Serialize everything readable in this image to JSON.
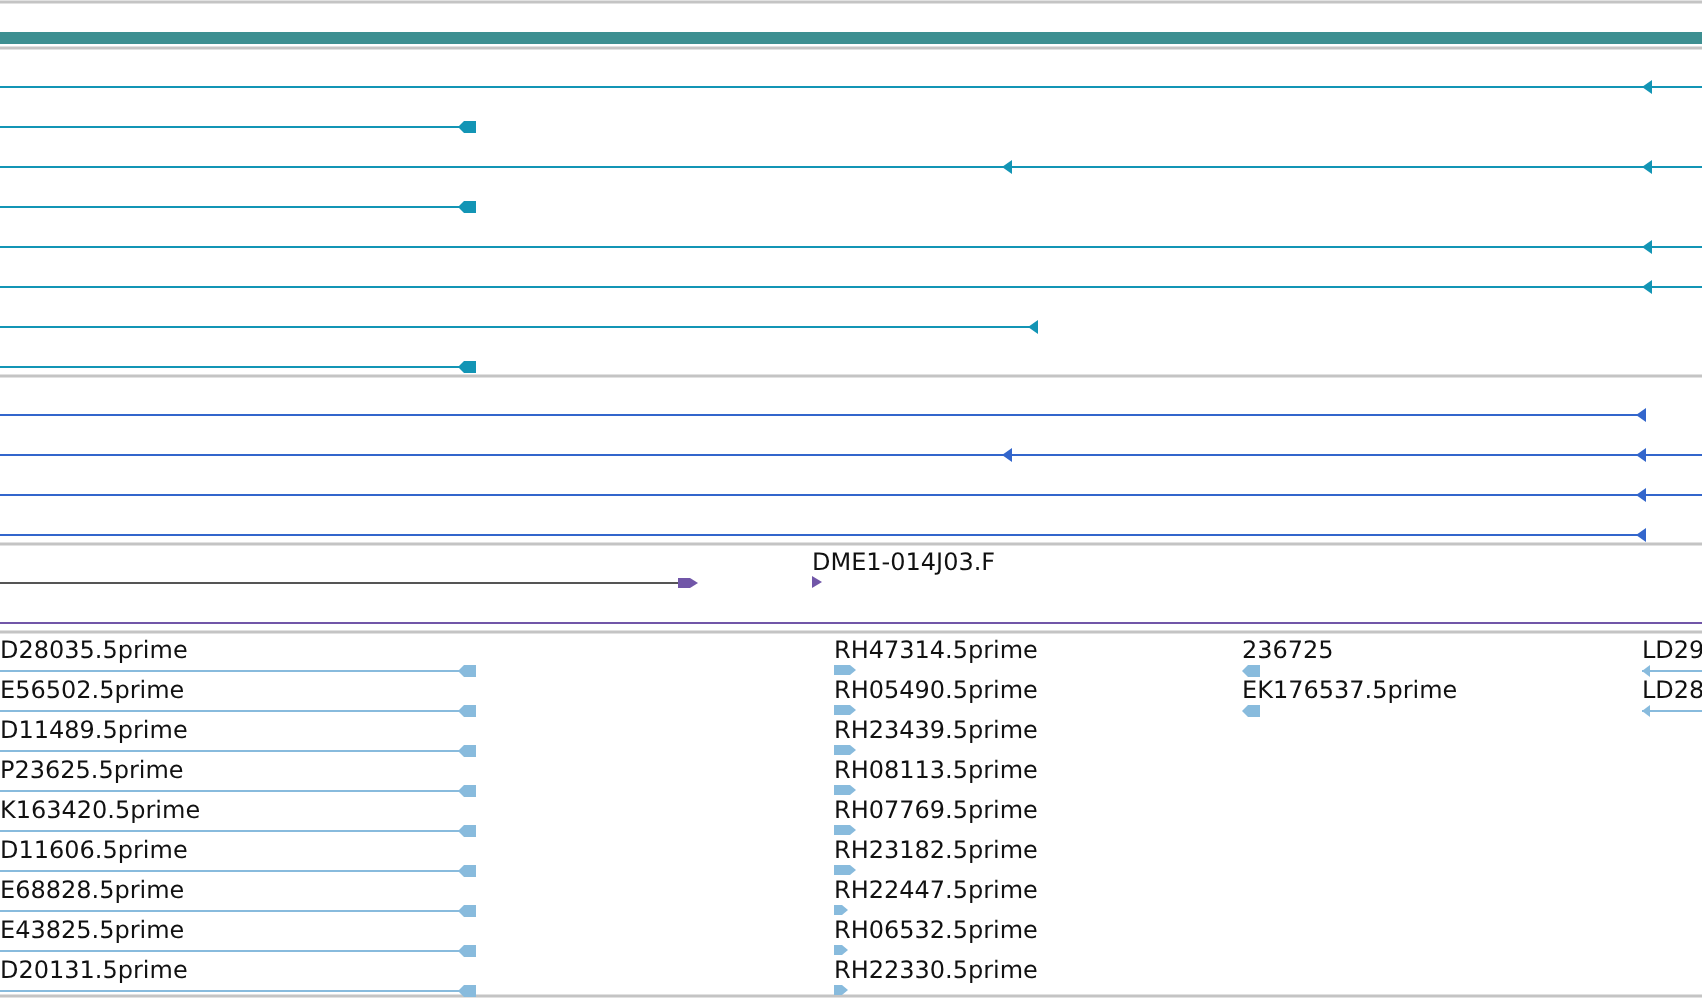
{
  "tracks": [
    {
      "kind": "bar",
      "color": "#3d8f91"
    },
    {
      "kind": "transcripts",
      "color": "#1395b5",
      "rows": [
        {
          "reverse": true
        },
        {
          "reverse": true
        },
        {
          "reverse": true
        },
        {
          "reverse": true
        },
        {
          "reverse": true
        },
        {
          "reverse": true
        },
        {
          "reverse": true
        },
        {
          "reverse": true
        }
      ]
    },
    {
      "kind": "transcripts",
      "color": "#3366cc",
      "rows": [
        {
          "reverse": true
        },
        {
          "reverse": true
        },
        {
          "reverse": true
        },
        {
          "reverse": true
        }
      ]
    },
    {
      "kind": "clones",
      "color": "#7156a8",
      "features": [
        {
          "reverse": false
        },
        {
          "label": "DME1-014J03.F",
          "reverse": false
        }
      ]
    },
    {
      "kind": "ests",
      "color": "#88bbdd",
      "columns": [
        {
          "items": [
            {
              "label": "D28035.5prime",
              "reverse": true
            },
            {
              "label": "E56502.5prime",
              "reverse": true
            },
            {
              "label": "D11489.5prime",
              "reverse": true
            },
            {
              "label": "P23625.5prime",
              "reverse": true
            },
            {
              "label": "K163420.5prime",
              "reverse": true
            },
            {
              "label": "D11606.5prime",
              "reverse": true
            },
            {
              "label": "E68828.5prime",
              "reverse": true
            },
            {
              "label": "E43825.5prime",
              "reverse": true
            },
            {
              "label": "D20131.5prime",
              "reverse": true
            }
          ]
        },
        {
          "items": [
            {
              "label": "RH47314.5prime",
              "reverse": false
            },
            {
              "label": "RH05490.5prime",
              "reverse": false
            },
            {
              "label": "RH23439.5prime",
              "reverse": false
            },
            {
              "label": "RH08113.5prime",
              "reverse": false
            },
            {
              "label": "RH07769.5prime",
              "reverse": false
            },
            {
              "label": "RH23182.5prime",
              "reverse": false
            },
            {
              "label": "RH22447.5prime",
              "reverse": false
            },
            {
              "label": "RH06532.5prime",
              "reverse": false
            },
            {
              "label": "RH22330.5prime",
              "reverse": false
            }
          ]
        },
        {
          "items": [
            {
              "label": "236725",
              "reverse": true
            },
            {
              "label": "EK176537.5prime",
              "reverse": true
            }
          ]
        },
        {
          "items": [
            {
              "label": "LD29",
              "reverse": true
            },
            {
              "label": "LD28",
              "reverse": true
            }
          ]
        }
      ]
    }
  ]
}
